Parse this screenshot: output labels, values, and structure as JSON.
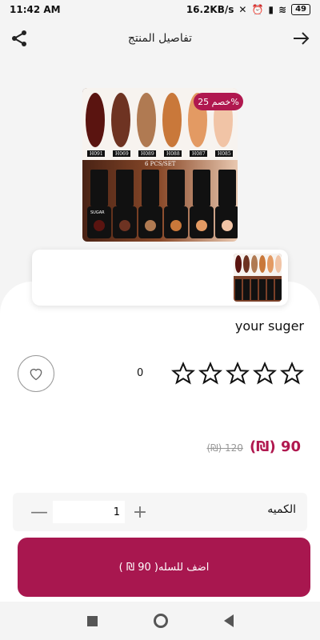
{
  "status": {
    "time": "11:42 AM",
    "speed": "16.2KB/s",
    "battery": "49"
  },
  "header": {
    "title": "تفاصيل المنتج"
  },
  "product": {
    "image_labels": [
      "H091",
      "H069",
      "H089",
      "H088",
      "H087",
      "H085"
    ],
    "set_label": "6 PCS/SET",
    "bottle_brand": "SUGAR",
    "discount_badge": "خصم 25%",
    "name": "your suger",
    "rating_count": "0",
    "rating_stars": 0,
    "price_new": "90 (₪)",
    "price_old": "120 (₪)"
  },
  "quantity": {
    "label": "الكميه",
    "value": "1",
    "minus": "—",
    "plus": "+"
  },
  "cart_button": {
    "label": "اضف للسله( 90 ₪ )"
  },
  "colors": {
    "accent": "#a8174f",
    "background": "#f4f4f4"
  }
}
